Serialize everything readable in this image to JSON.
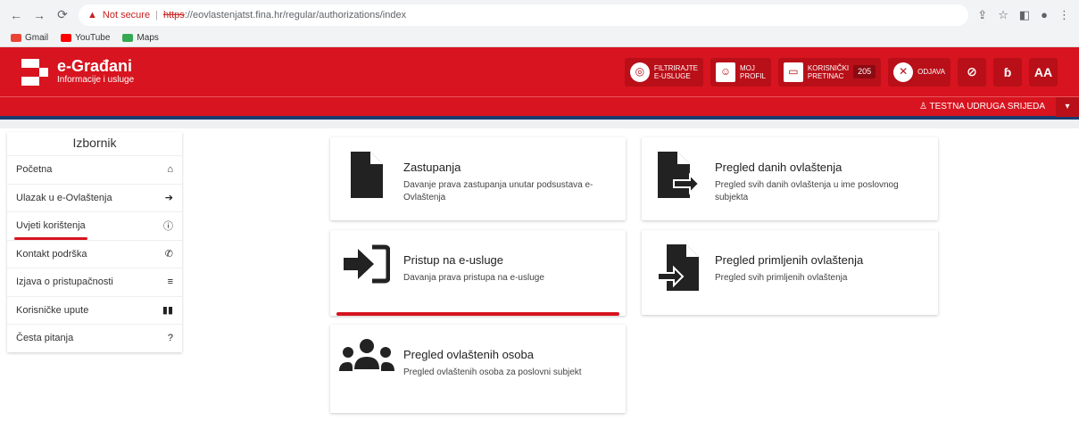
{
  "browser": {
    "not_secure": "Not secure",
    "protocol": "https",
    "url_rest": "://eovlastenjatst.fina.hr/regular/authorizations/index"
  },
  "bookmarks": [
    {
      "label": "Gmail",
      "color": "#ea4335"
    },
    {
      "label": "YouTube",
      "color": "#ff0000"
    },
    {
      "label": "Maps",
      "color": "#34a853"
    }
  ],
  "header": {
    "title": "e-Građani",
    "subtitle": "Informacije i usluge",
    "filter_l1": "FILTRIRAJTE",
    "filter_l2": "E-USLUGE",
    "profile_l1": "MOJ",
    "profile_l2": "PROFIL",
    "inbox_l1": "KORISNIČKI",
    "inbox_l2": "PRETINAC",
    "inbox_count": "205",
    "logout": "ODJAVA",
    "dyslexia": "ɓ",
    "font_size": "AA"
  },
  "subheader": {
    "user": "TESTNA UDRUGA SRIJEDA"
  },
  "sidebar": {
    "title": "Izbornik",
    "items": [
      {
        "label": "Početna",
        "icon": "home-icon"
      },
      {
        "label": "Ulazak u e-Ovlaštenja",
        "icon": "sign-in-icon"
      },
      {
        "label": "Uvjeti korištenja",
        "icon": "info-icon"
      },
      {
        "label": "Kontakt podrška",
        "icon": "phone-icon"
      },
      {
        "label": "Izjava o pristupačnosti",
        "icon": "align-icon"
      },
      {
        "label": "Korisničke upute",
        "icon": "book-icon"
      },
      {
        "label": "Česta pitanja",
        "icon": "question-icon"
      }
    ]
  },
  "cards": [
    {
      "title": "Zastupanja",
      "desc": "Davanje prava zastupanja unutar podsustava e-Ovlaštenja",
      "icon": "document-icon"
    },
    {
      "title": "Pregled danih ovlaštenja",
      "desc": "Pregled svih danih ovlaštenja u ime poslovnog subjekta",
      "icon": "document-export-icon"
    },
    {
      "title": "Pristup na e-usluge",
      "desc": "Davanja prava pristupa na e-usluge",
      "icon": "sign-in-icon"
    },
    {
      "title": "Pregled primljenih ovlaštenja",
      "desc": "Pregled svih primljenih ovlaštenja",
      "icon": "document-import-icon"
    },
    {
      "title": "Pregled ovlaštenih osoba",
      "desc": "Pregled ovlaštenih osoba za poslovni subjekt",
      "icon": "users-icon"
    }
  ]
}
